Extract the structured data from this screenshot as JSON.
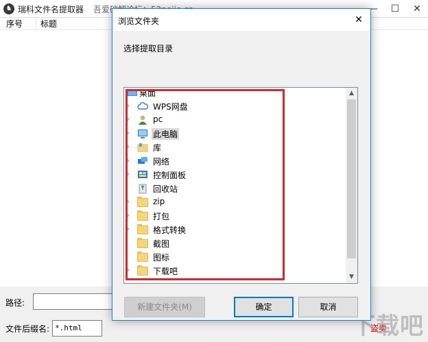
{
  "app": {
    "title": "瑞科文件名提取器",
    "subtitle": "吾爱破解论坛：52pojie.cn",
    "minimize": "—",
    "maximize": "☐",
    "close": "✕"
  },
  "list": {
    "columns": [
      "序号",
      "标题"
    ]
  },
  "bottom": {
    "path_label": "路径:",
    "path_value": "",
    "suffix_label": "文件后缀名:",
    "suffix_value": "*.html",
    "red_fragment": "盗卖"
  },
  "dialog": {
    "title": "浏览文件夹",
    "close": "✕",
    "prompt": "选择提取目录",
    "tree": [
      {
        "label": "桌面",
        "icon": "desktop-icon",
        "expandable": false,
        "top_level": true
      },
      {
        "label": "WPS网盘",
        "icon": "cloud-icon",
        "expandable": true
      },
      {
        "label": "pc",
        "icon": "user-icon",
        "expandable": true
      },
      {
        "label": "此电脑",
        "icon": "computer-icon",
        "expandable": true,
        "selected": true
      },
      {
        "label": "库",
        "icon": "library-icon",
        "expandable": true
      },
      {
        "label": "网络",
        "icon": "network-icon",
        "expandable": true
      },
      {
        "label": "控制面板",
        "icon": "control-panel-icon",
        "expandable": true
      },
      {
        "label": "回收站",
        "icon": "recycle-bin-icon",
        "expandable": false
      },
      {
        "label": "zip",
        "icon": "folder-icon",
        "expandable": true
      },
      {
        "label": "打包",
        "icon": "folder-icon",
        "expandable": true
      },
      {
        "label": "格式转换",
        "icon": "folder-icon",
        "expandable": true
      },
      {
        "label": "截图",
        "icon": "folder-icon",
        "expandable": false
      },
      {
        "label": "图标",
        "icon": "folder-icon",
        "expandable": false
      },
      {
        "label": "下载吧",
        "icon": "folder-icon",
        "expandable": true
      }
    ],
    "buttons": {
      "new_folder": "新建文件夹(M)",
      "ok": "确定",
      "cancel": "取消"
    }
  },
  "colors": {
    "highlight_box": "#d8262b",
    "dialog_border": "#1883d7",
    "default_button_border": "#0078d7"
  }
}
